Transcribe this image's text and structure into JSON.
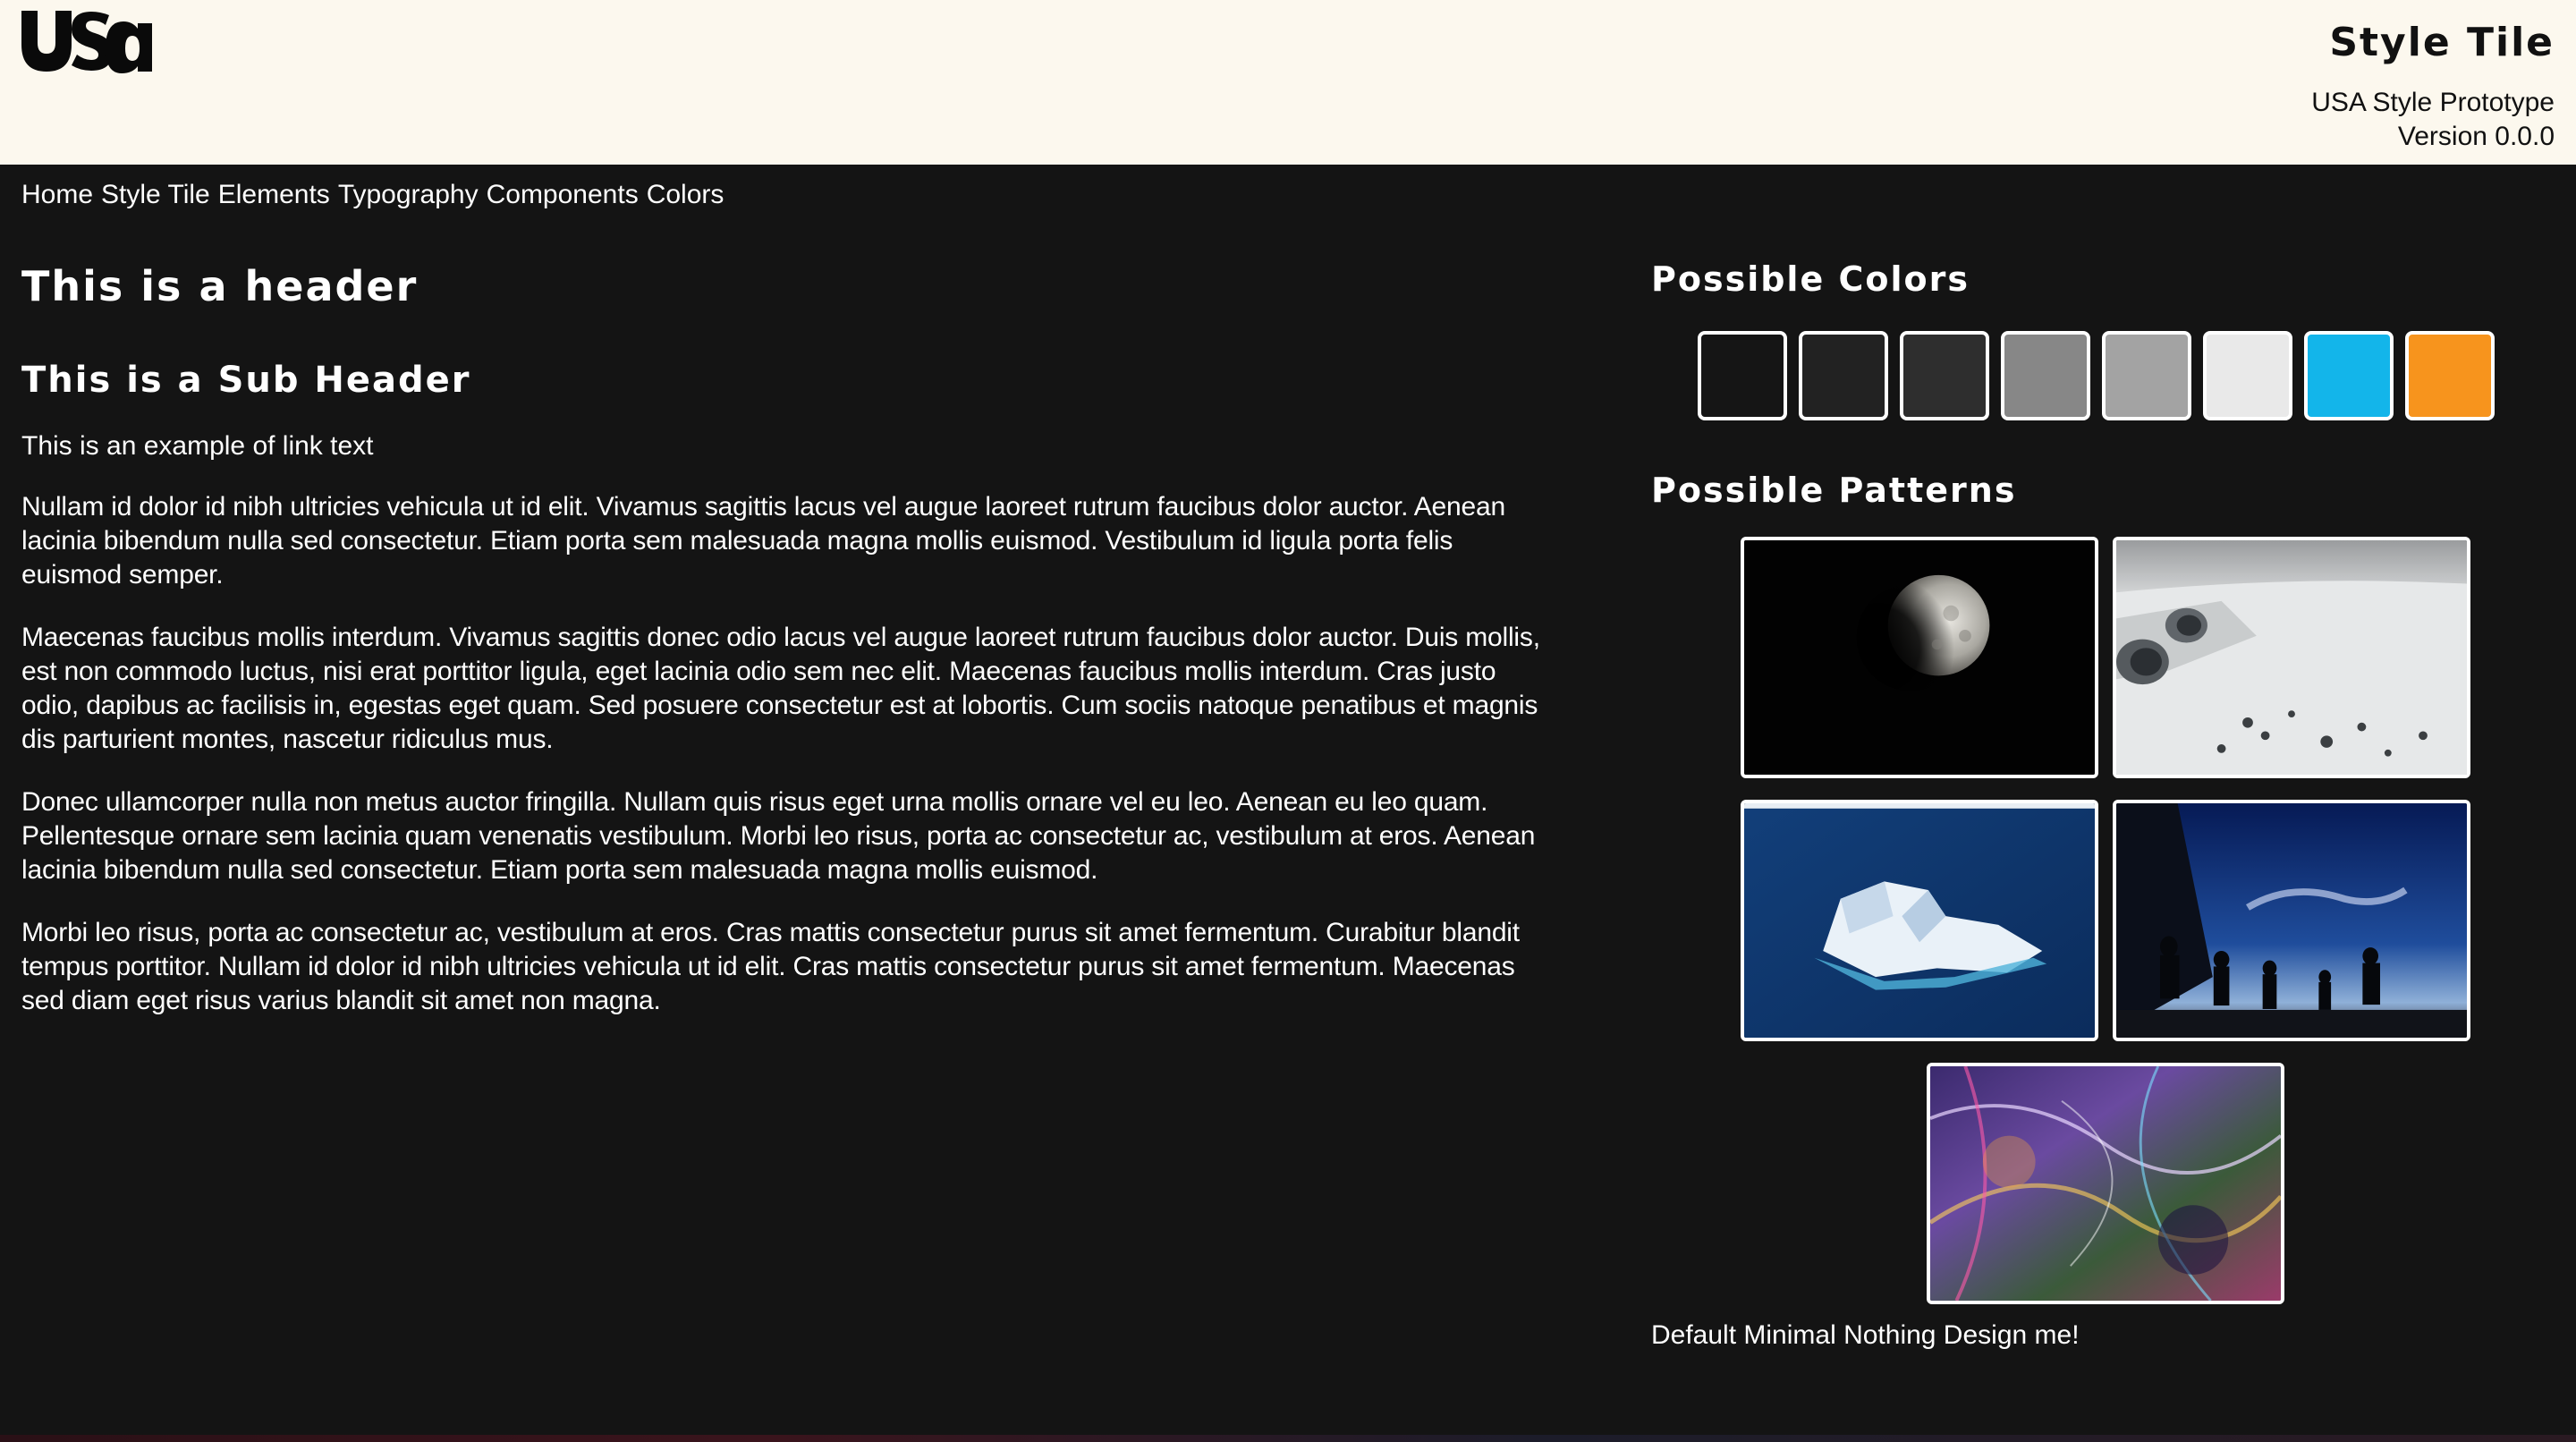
{
  "header": {
    "logo_text": "usa",
    "title": "Style Tile",
    "subtitle": "USA Style Prototype",
    "version": "Version 0.0.0"
  },
  "nav": {
    "items": [
      {
        "label": "Home"
      },
      {
        "label": "Style Tile"
      },
      {
        "label": "Elements"
      },
      {
        "label": "Typography"
      },
      {
        "label": "Components"
      },
      {
        "label": "Colors"
      }
    ]
  },
  "main": {
    "header": "This is a header",
    "sub_header": "This is a Sub Header",
    "link_text": "This is an example of link text",
    "paragraphs": [
      "Nullam id dolor id nibh ultricies vehicula ut id elit. Vivamus sagittis lacus vel augue laoreet rutrum faucibus dolor auctor. Aenean lacinia bibendum nulla sed consectetur. Etiam porta sem malesuada magna mollis euismod. Vestibulum id ligula porta felis euismod semper.",
      "Maecenas faucibus mollis interdum. Vivamus sagittis donec odio lacus vel augue laoreet rutrum faucibus dolor auctor. Duis mollis, est non commodo luctus, nisi erat porttitor ligula, eget lacinia odio sem nec elit. Maecenas faucibus mollis interdum. Cras justo odio, dapibus ac facilisis in, egestas eget quam. Sed posuere consectetur est at lobortis. Cum sociis natoque penatibus et magnis dis parturient montes, nascetur ridiculus mus.",
      "Donec ullamcorper nulla non metus auctor fringilla. Nullam quis risus eget urna mollis ornare vel eu leo. Aenean eu leo quam. Pellentesque ornare sem lacinia quam venenatis vestibulum. Morbi leo risus, porta ac consectetur ac, vestibulum at eros. Aenean lacinia bibendum nulla sed consectetur. Etiam porta sem malesuada magna mollis euismod.",
      "Morbi leo risus, porta ac consectetur ac, vestibulum at eros. Cras mattis consectetur purus sit amet fermentum. Curabitur blandit tempus porttitor. Nullam id dolor id nibh ultricies vehicula ut id elit. Cras mattis consectetur purus sit amet fermentum. Maecenas sed diam eget risus varius blandit sit amet non magna."
    ]
  },
  "sidebar": {
    "colors_title": "Possible Colors",
    "colors": [
      "#151515",
      "#222222",
      "#2e2e2e",
      "#878787",
      "#a3a3a3",
      "#e9e9e9",
      "#13b5ea",
      "#f7941d"
    ],
    "patterns_title": "Possible Patterns",
    "patterns": [
      {
        "name": "moon-eclipse"
      },
      {
        "name": "aircraft-over-snow"
      },
      {
        "name": "iceberg"
      },
      {
        "name": "silhouettes-night-sky"
      },
      {
        "name": "abstract-colors"
      }
    ],
    "footer_text": "Default Minimal Nothing Design me!"
  },
  "theme": {
    "background": "#141414",
    "header_background": "#fcf8ee",
    "text": "#ffffff"
  }
}
